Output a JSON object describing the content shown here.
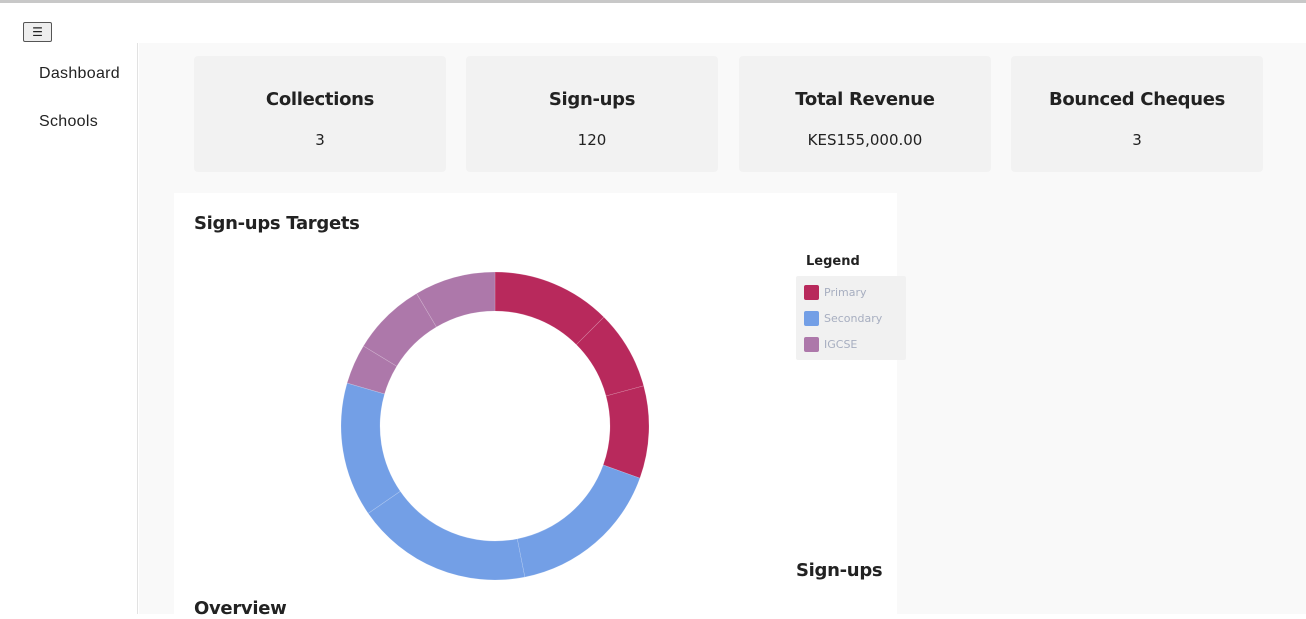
{
  "topbar": {
    "menu_icon": "☰"
  },
  "sidebar": {
    "items": [
      {
        "label": "Dashboard"
      },
      {
        "label": "Schools"
      }
    ]
  },
  "cards": [
    {
      "title": "Collections",
      "value": "3"
    },
    {
      "title": "Sign-ups",
      "value": "120"
    },
    {
      "title": "Total Revenue",
      "value": "KES155,000.00"
    },
    {
      "title": "Bounced Cheques",
      "value": "3"
    }
  ],
  "panel": {
    "title": "Sign-ups Targets",
    "footer_label": "Sign-ups"
  },
  "overview": {
    "title": "Overview"
  },
  "chart_data": {
    "type": "pie",
    "title": "Sign-ups Targets",
    "legend_title": "Legend",
    "legend_position": "right",
    "categories": [
      "Primary",
      "Secondary",
      "IGCSE"
    ],
    "colors": [
      "#b8295c",
      "#739fe6",
      "#ad78aa"
    ],
    "slices": [
      {
        "category": "Primary",
        "value": 12.5
      },
      {
        "category": "Primary",
        "value": 8.3
      },
      {
        "category": "Primary",
        "value": 9.7
      },
      {
        "category": "Secondary",
        "value": 16.4
      },
      {
        "category": "Secondary",
        "value": 18.5
      },
      {
        "category": "Secondary",
        "value": 14.1
      },
      {
        "category": "IGCSE",
        "value": 4.2
      },
      {
        "category": "IGCSE",
        "value": 7.8
      },
      {
        "category": "IGCSE",
        "value": 8.5
      }
    ]
  }
}
